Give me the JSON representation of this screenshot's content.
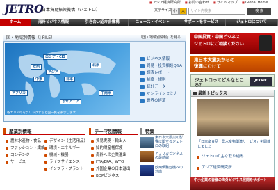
{
  "header": {
    "logo": "JETRO",
    "org_name": "日本貿易振興機構（ジェトロ）",
    "top_links": [
      "アジア経済研究所",
      "お問い合わせ",
      "サイトマップ",
      "Global Home"
    ],
    "font_size_label": "文字サイズ",
    "font_size_options": [
      "小",
      "大"
    ],
    "search_placeholder": "サイト内検索",
    "search_button": "検 索"
  },
  "nav": {
    "items": [
      "ホーム",
      "海外ビジネス情報",
      "引き合い紹介会機構",
      "ニュース・イベント",
      "サポートをサービス",
      "ジェトロについて"
    ]
  },
  "map_section": {
    "title": "国・地域別情報",
    "title_suffix": "（J-FILE）",
    "right_link": "「国・地域別情報」を見る",
    "regions": [
      "ロシア・CIS",
      "欧州",
      "中東",
      "アジア",
      "日本",
      "北米",
      "中南米",
      "アフリカ",
      "オセアニア"
    ],
    "links": [
      "ビジネス情報",
      "貿易・投資相談Q&A",
      "調査レポート",
      "制度・規則",
      "統計データ",
      "オンラインセミナー",
      "世界の経済"
    ],
    "note": "各エリアのをクリックすると国一覧を表示します。"
  },
  "industry": {
    "title": "産業別情報",
    "col1": [
      "農林水産物・食品",
      "ファッション・繊維",
      "コンテンツ",
      "サービス"
    ],
    "col2": [
      "デザイン（生活用品）",
      "環境・エネルギー",
      "機械・機器",
      "ライフサイエンス",
      "インフラ・プラント"
    ]
  },
  "themes": {
    "title": "テーマ別情報",
    "items": [
      "貿易実務・輸出入",
      "知的財産権保護",
      "海外への企業進出",
      "FTA/EPA、WTO",
      "外国企業の日本進出",
      "BOPビジネス"
    ]
  },
  "tokushu": {
    "title": "特集",
    "items": [
      "東日本大震災の影響に関するジェトロの取組",
      "アフリカビジネスの最前線",
      "欧州債務危機への対応"
    ]
  },
  "sidebar": {
    "ad1_line1": "中国投資・中国ビジネス",
    "ad1_line2": "ジェトロにご相談ください",
    "ad2_line1": "東日本大震災からの",
    "ad2_line2": "復興にむけて",
    "ad3_text": "ジェトロってどんなところ？",
    "ad3_badge": "JETRO",
    "news_title": "最新トピックス",
    "news_caption": "「日本産食品・農水産物関連サービス」を開催しました",
    "news_links": [
      "ジェトロの主な取り組み",
      "アジア経済研究所"
    ],
    "bottom_ad": "中小企業の皆様の海外ビジネス展開をサポート"
  },
  "colors": {
    "nav_active": "#c40000",
    "map_blue": "#1d74c0",
    "section_accent": "#d04a00"
  }
}
